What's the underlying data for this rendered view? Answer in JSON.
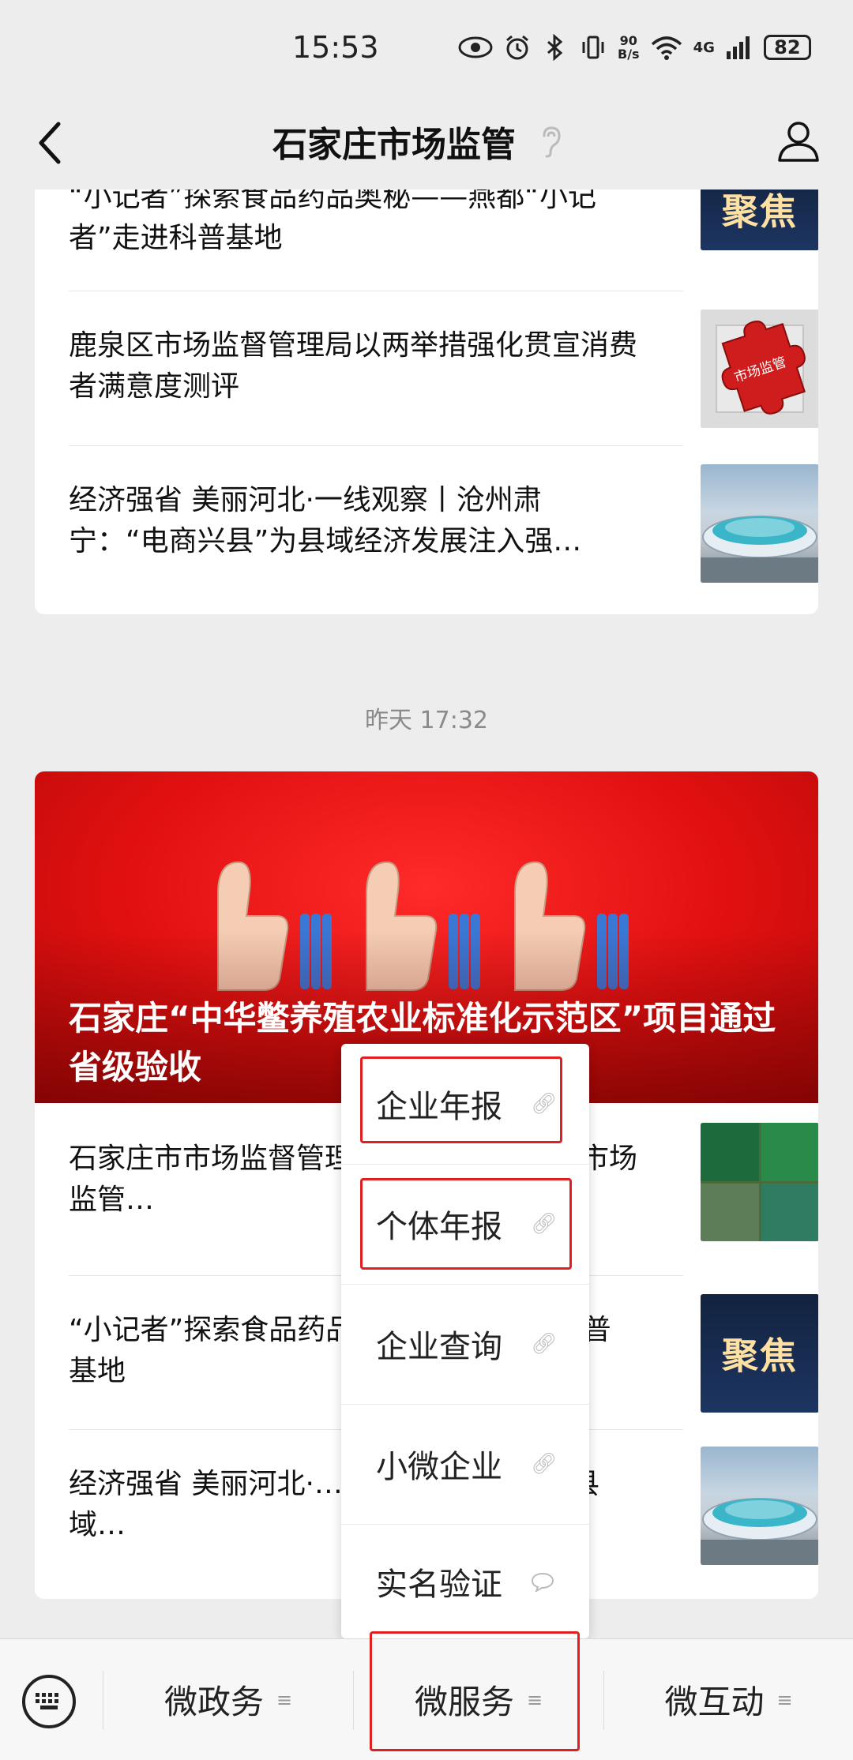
{
  "status_bar": {
    "time": "15:53",
    "net_speed_top": "90",
    "net_speed_bottom": "B/s",
    "network": "4G",
    "battery": "82"
  },
  "header": {
    "title": "石家庄市场监管"
  },
  "card1": {
    "items": [
      {
        "text": "“小记者”探索食品药品奥秘——燕都“小记者”走进科普基地",
        "thumb_label": "聚焦"
      },
      {
        "text": "鹿泉区市场监督管理局以两举措强化贯宣消费者满意度测评",
        "thumb_label": "市场监管"
      },
      {
        "text": "经济强省 美丽河北·一线观察丨沧州肃宁：“电商兴县”为县域经济发展注入强…"
      }
    ]
  },
  "timestamp": "昨天 17:32",
  "card2": {
    "hero_title": "石家庄“中华鳖养殖农业标准化示范区”项目通过省级验收",
    "items": [
      {
        "text": "石家庄市市场监督管理局…健体先锋、展市场监管…"
      },
      {
        "text": "“小记者”探索食品药品…“小记者”走进科普基地",
        "thumb_label": "聚焦"
      },
      {
        "text": "经济强省 美丽河北·…宁：“电商兴县”为县域…"
      }
    ]
  },
  "popup_menu": {
    "items": [
      {
        "label": "企业年报",
        "icon": "link-icon"
      },
      {
        "label": "个体年报",
        "icon": "link-icon"
      },
      {
        "label": "企业查询",
        "icon": "link-icon"
      },
      {
        "label": "小微企业",
        "icon": "link-icon"
      },
      {
        "label": "实名验证",
        "icon": "chat-bubble-icon"
      }
    ]
  },
  "bottom_bar": {
    "tabs": [
      {
        "label": "微政务"
      },
      {
        "label": "微服务"
      },
      {
        "label": "微互动"
      }
    ]
  },
  "colors": {
    "highlight_box": "#e02020",
    "hero_red": "#e11010",
    "background": "#ededed"
  }
}
